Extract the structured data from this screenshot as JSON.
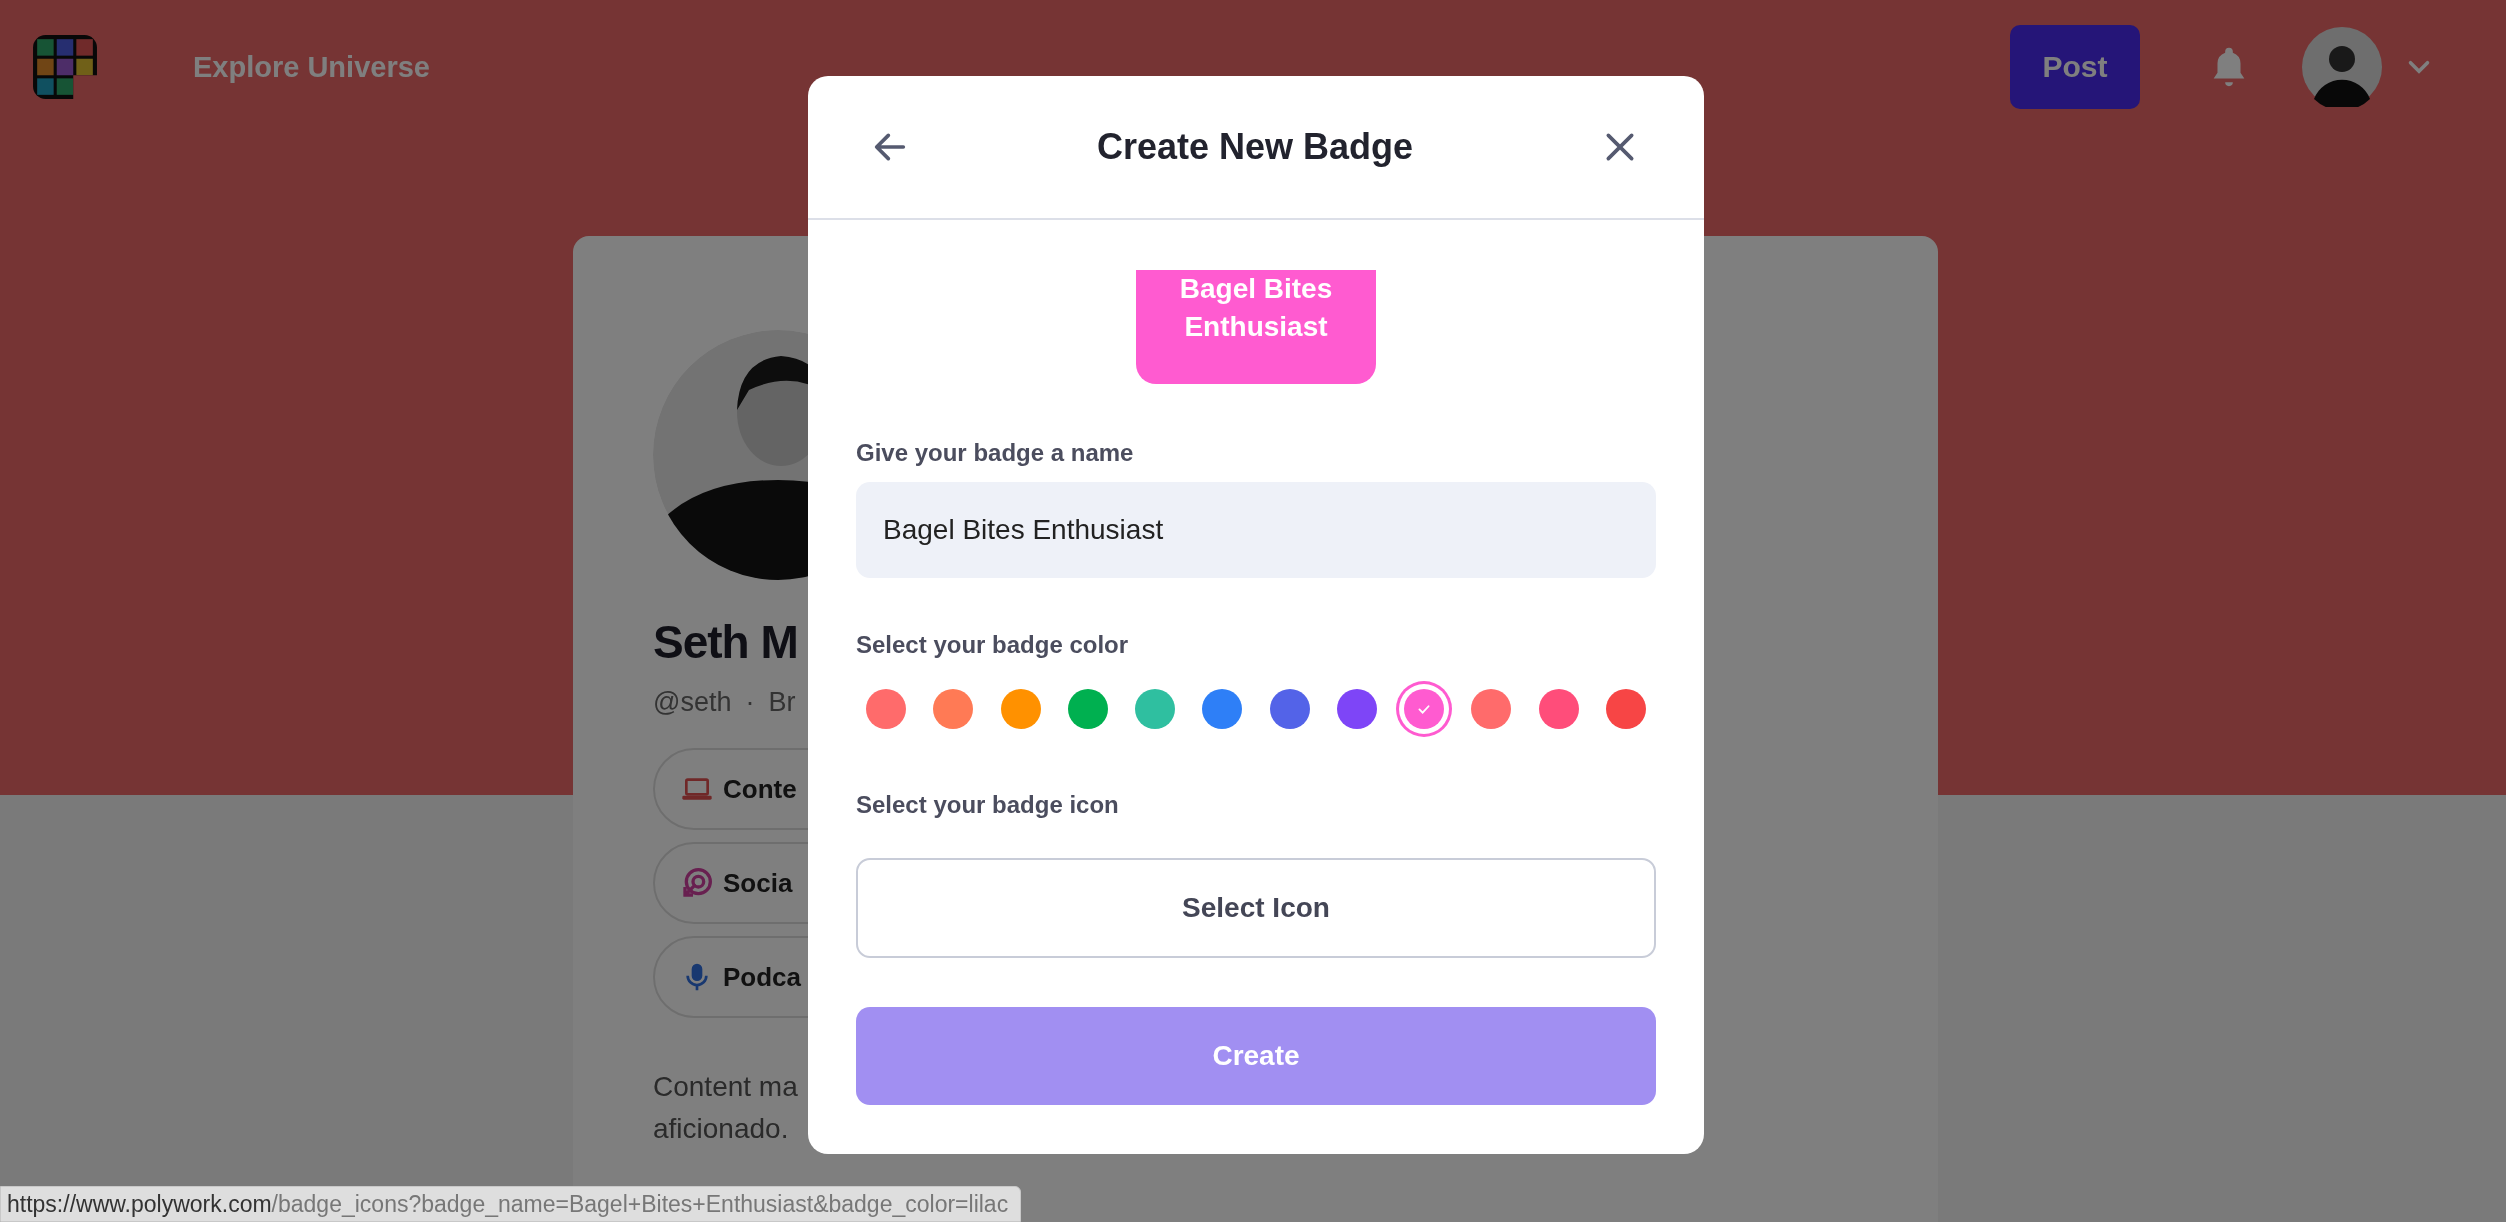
{
  "nav": {
    "explore_link": "Explore Universe",
    "post_button": "Post"
  },
  "profile": {
    "name": "Seth M",
    "handle": "@seth",
    "separator": "·",
    "handle_tail": "Br",
    "pills": [
      {
        "kind": "laptop",
        "label": "Conte"
      },
      {
        "kind": "target",
        "label": "Socia"
      },
      {
        "kind": "mic",
        "label": "Podca"
      }
    ],
    "bio_lines": [
      "Content ma",
      "aficionado."
    ]
  },
  "modal": {
    "title": "Create New Badge",
    "badge_preview": "Bagel Bites Enthusiast",
    "name_label": "Give your badge a name",
    "name_value": "Bagel Bites Enthusiast",
    "color_label": "Select your badge color",
    "colors": [
      {
        "color": "#ff6b6b",
        "selected": false
      },
      {
        "color": "#ff7a55",
        "selected": false
      },
      {
        "color": "#ff9100",
        "selected": false
      },
      {
        "color": "#00b050",
        "selected": false
      },
      {
        "color": "#2fbfa0",
        "selected": false
      },
      {
        "color": "#2e7ff7",
        "selected": false
      },
      {
        "color": "#5363e8",
        "selected": false
      },
      {
        "color": "#7e45f7",
        "selected": false
      },
      {
        "color": "#ff5bd0",
        "selected": true
      },
      {
        "color": "#ff6b6b",
        "selected": false
      },
      {
        "color": "#ff4d7a",
        "selected": false
      },
      {
        "color": "#f74545",
        "selected": false
      }
    ],
    "icon_label": "Select your badge icon",
    "select_icon_button": "Select Icon",
    "create_button": "Create"
  },
  "status_bar": {
    "host": "https://www.polywork.com",
    "path": "/badge_icons?badge_name=Bagel+Bites+Enthusiast&badge_color=lilac"
  }
}
